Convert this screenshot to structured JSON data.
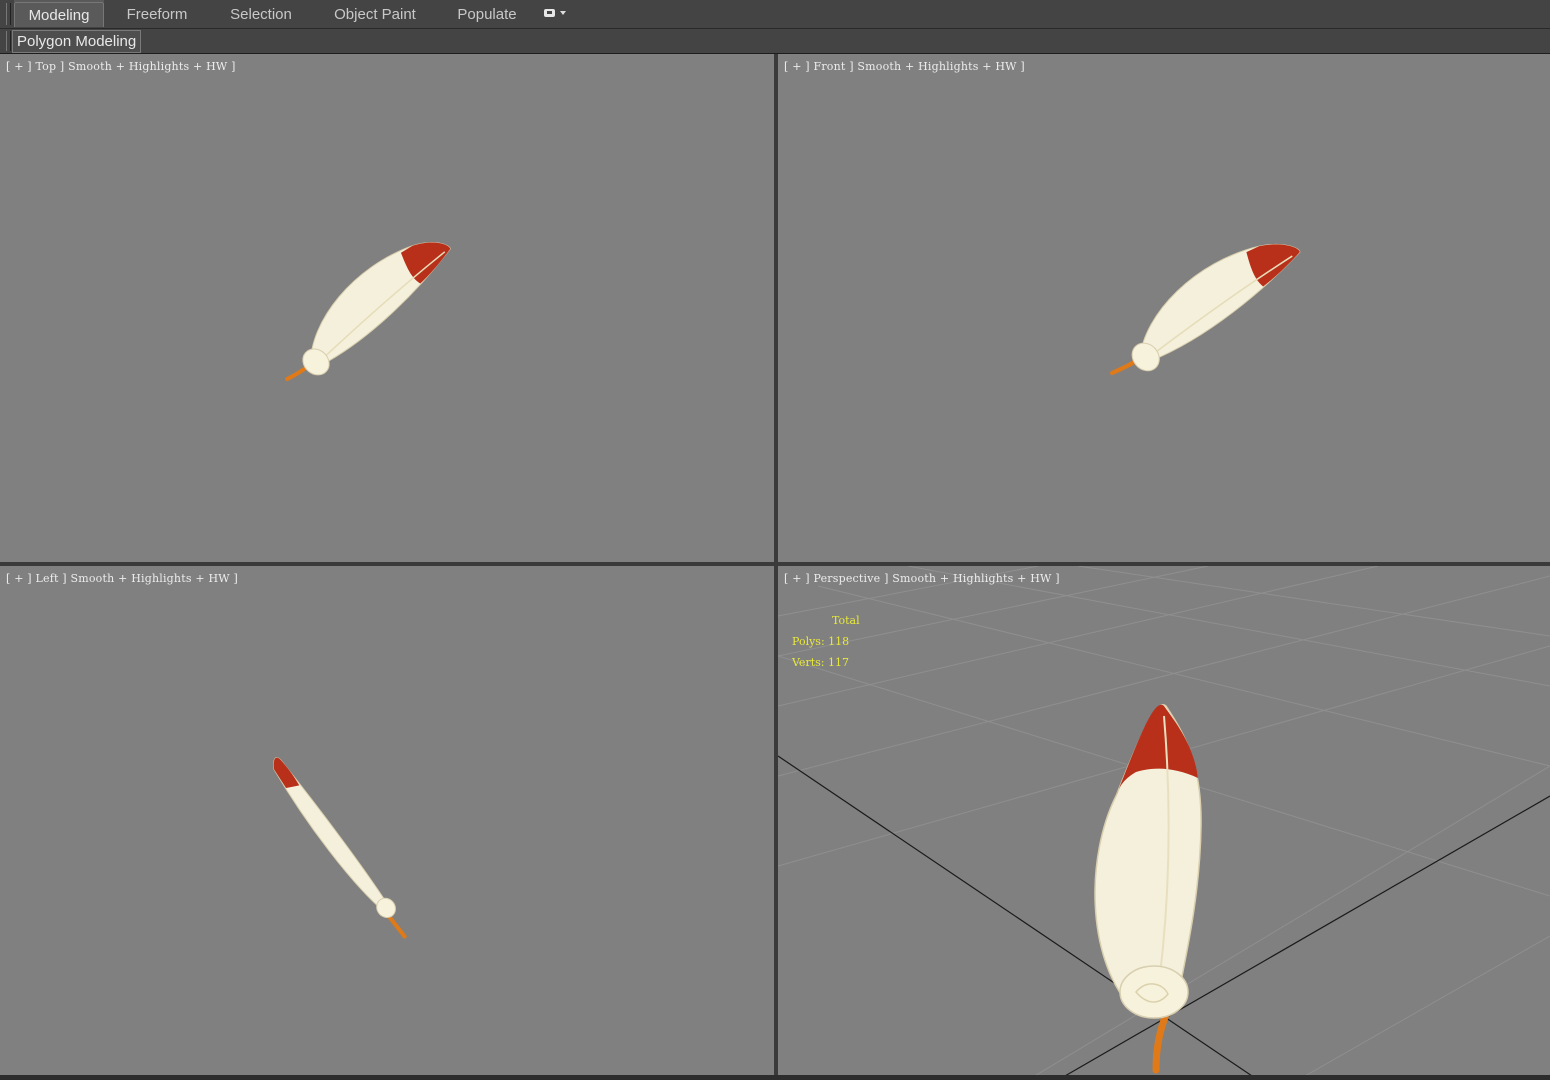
{
  "ribbon": {
    "tabs": [
      {
        "label": "Modeling",
        "active": true
      },
      {
        "label": "Freeform",
        "active": false
      },
      {
        "label": "Selection",
        "active": false
      },
      {
        "label": "Object Paint",
        "active": false
      },
      {
        "label": "Populate",
        "active": false
      }
    ],
    "more_icon": "ribbon-options-icon",
    "panel_title": "Polygon Modeling"
  },
  "viewports": [
    {
      "id": "top",
      "label": "[ + ] Top ] Smooth + Highlights + HW ]"
    },
    {
      "id": "front",
      "label": "[ + ] Front ] Smooth + Highlights + HW ]"
    },
    {
      "id": "left",
      "label": "[ + ] Left ] Smooth + Highlights + HW ]"
    },
    {
      "id": "perspective",
      "label": "[ + ] Perspective ] Smooth + Highlights + HW ]",
      "stats": {
        "total": "Total",
        "polys": "Polys: 118",
        "verts": "Verts: 117"
      }
    }
  ],
  "colors": {
    "viewport_bg": "#808080",
    "feather_tip": "#b8301a",
    "feather_body": "#f4f0dc",
    "feather_quill": "#e07a18",
    "stats_text": "#e8e83a"
  }
}
